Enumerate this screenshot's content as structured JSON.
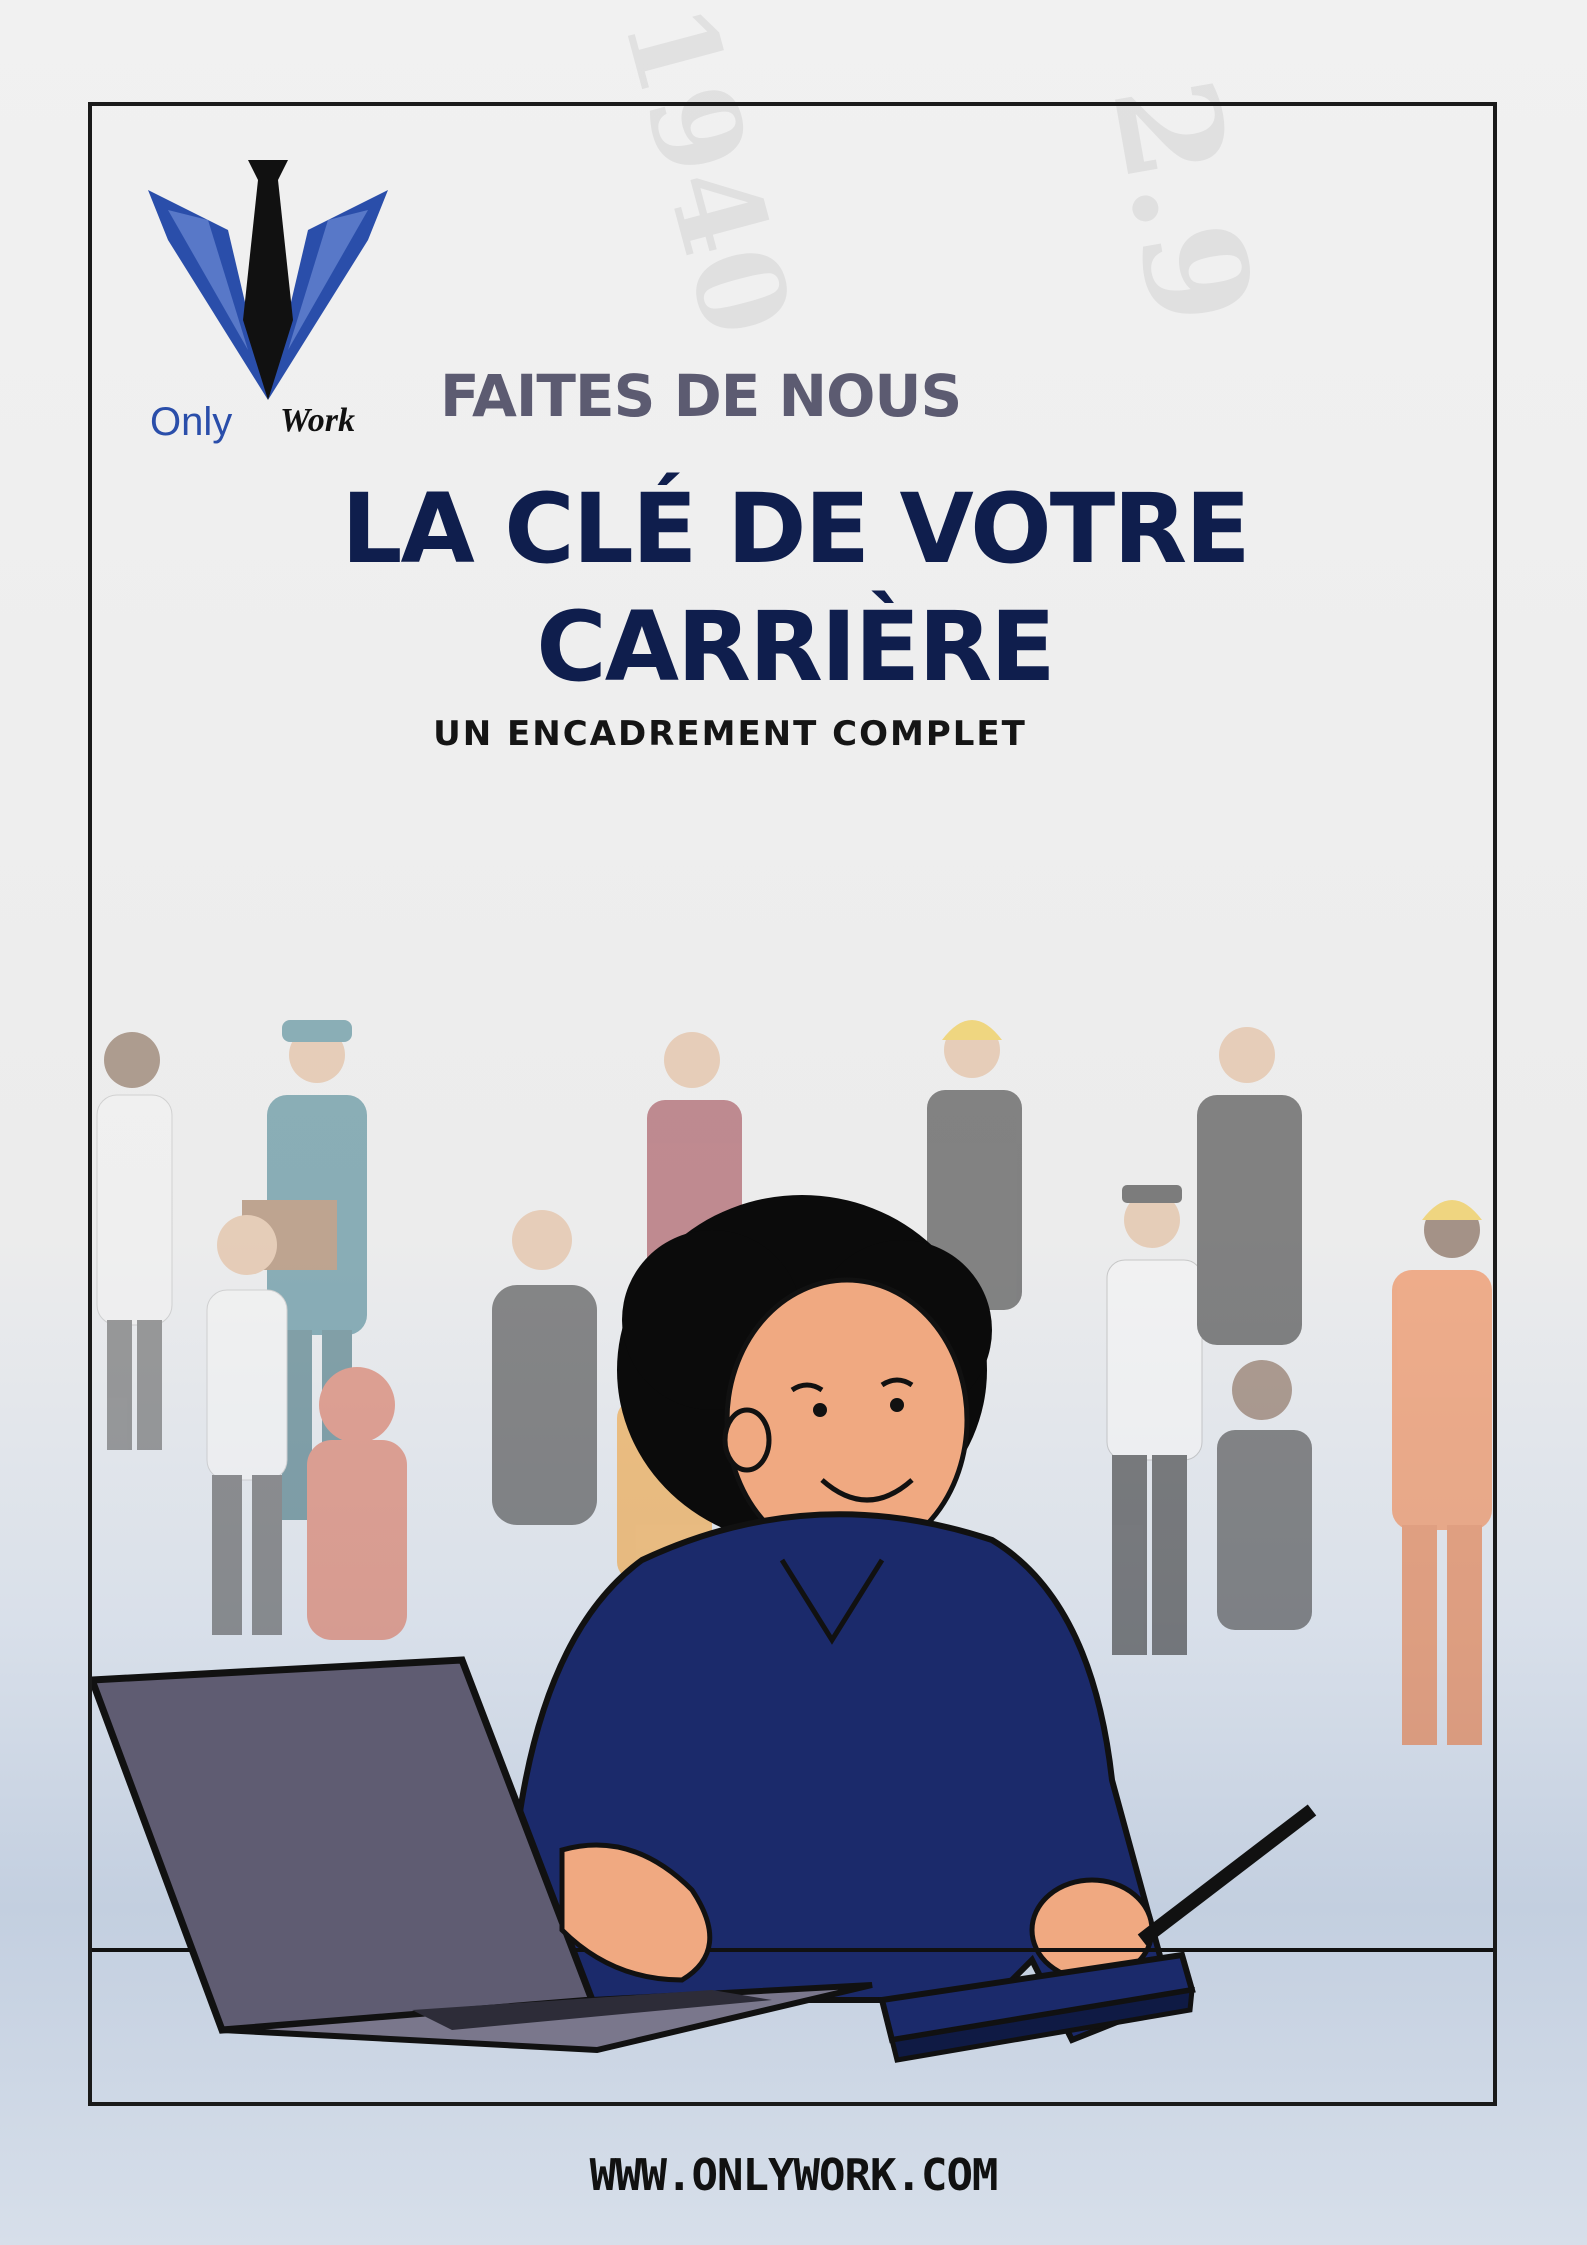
{
  "brand": {
    "name_primary": "Only",
    "name_secondary": "Work"
  },
  "hero": {
    "kicker": "FAITES DE NOUS",
    "headline_line1": "LA CLÉ DE VOTRE",
    "headline_line2": "CARRIÈRE",
    "subtitle": "UN ENCADREMENT COMPLET"
  },
  "footer": {
    "website": "WWW.ONLYWORK.COM"
  },
  "colors": {
    "headline": "#0f1e4d",
    "kicker": "#5c5b71",
    "logo_blue": "#2a4eaa",
    "shirt": "#1b2a6b",
    "laptop": "#5f5c72"
  },
  "icons": [
    "tie-logo-icon",
    "laptop-icon",
    "notebook-icon",
    "pen-icon"
  ]
}
